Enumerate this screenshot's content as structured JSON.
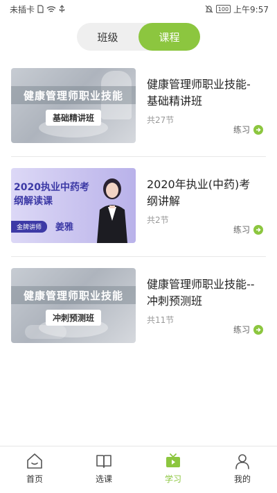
{
  "status_bar": {
    "left_text": "未插卡",
    "battery": "100",
    "time": "上午9:57"
  },
  "tabs": {
    "items": [
      {
        "label": "班级",
        "active": false
      },
      {
        "label": "课程",
        "active": true
      }
    ]
  },
  "courses": [
    {
      "thumb_title": "健康管理师职业技能",
      "thumb_tag": "基础精讲班",
      "title": "健康管理师职业技能-基础精讲班",
      "count": "共27节",
      "action": "练习"
    },
    {
      "thumb_title": "2020执业中药考纲解读课",
      "thumb_badge": "金牌讲师",
      "thumb_name": "姜雅",
      "title": "2020年执业(中药)考纲讲解",
      "count": "共2节",
      "action": "练习"
    },
    {
      "thumb_title": "健康管理师职业技能",
      "thumb_tag": "冲刺预测班",
      "title": "健康管理师职业技能--冲刺预测班",
      "count": "共11节",
      "action": "练习"
    }
  ],
  "nav": {
    "items": [
      {
        "label": "首页",
        "icon": "home-icon"
      },
      {
        "label": "选课",
        "icon": "book-icon"
      },
      {
        "label": "学习",
        "icon": "tv-icon",
        "active": true
      },
      {
        "label": "我的",
        "icon": "user-icon"
      }
    ]
  },
  "colors": {
    "accent": "#8cc63f"
  }
}
